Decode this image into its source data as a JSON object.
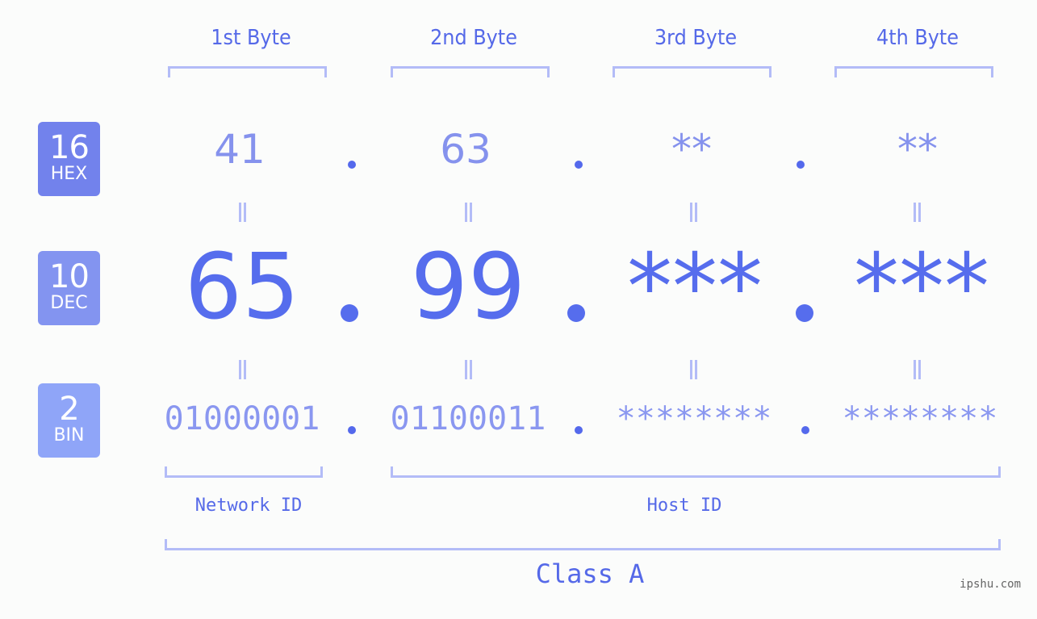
{
  "bytes": [
    {
      "header": "1st Byte",
      "hex": "41",
      "dec": "65",
      "bin": "01000001"
    },
    {
      "header": "2nd Byte",
      "hex": "63",
      "dec": "99",
      "bin": "01100011"
    },
    {
      "header": "3rd Byte",
      "hex": "**",
      "dec": "***",
      "bin": "********"
    },
    {
      "header": "4th Byte",
      "hex": "**",
      "dec": "***",
      "bin": "********"
    }
  ],
  "badges": {
    "hex": {
      "num": "16",
      "label": "HEX"
    },
    "dec": {
      "num": "10",
      "label": "DEC"
    },
    "bin": {
      "num": "2",
      "label": "BIN"
    }
  },
  "labels": {
    "network_id": "Network ID",
    "host_id": "Host ID",
    "class": "Class A"
  },
  "watermark": "ipshu.com",
  "colors": {
    "accent": "#5569e8",
    "bracket": "#b3bcf7",
    "hex_badge": "#7282ec",
    "dec_badge": "#8394f0",
    "bin_badge": "#8fa5f8"
  }
}
